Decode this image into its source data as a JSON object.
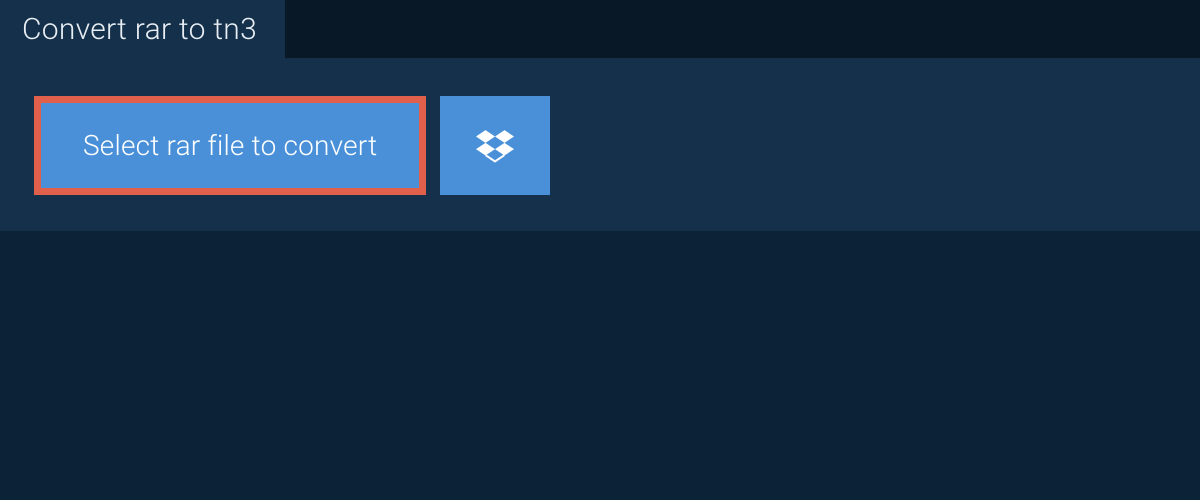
{
  "header": {
    "title": "Convert rar to tn3"
  },
  "actions": {
    "select_file_label": "Select rar file to convert",
    "dropbox_icon": "dropbox-icon"
  },
  "colors": {
    "page_bg": "#0c2237",
    "top_bg": "#081826",
    "card_bg": "#14304a",
    "button_bg": "#4a90d9",
    "highlight_border": "#e0604c",
    "text_light": "#e8eef4",
    "text_white": "#ffffff"
  }
}
